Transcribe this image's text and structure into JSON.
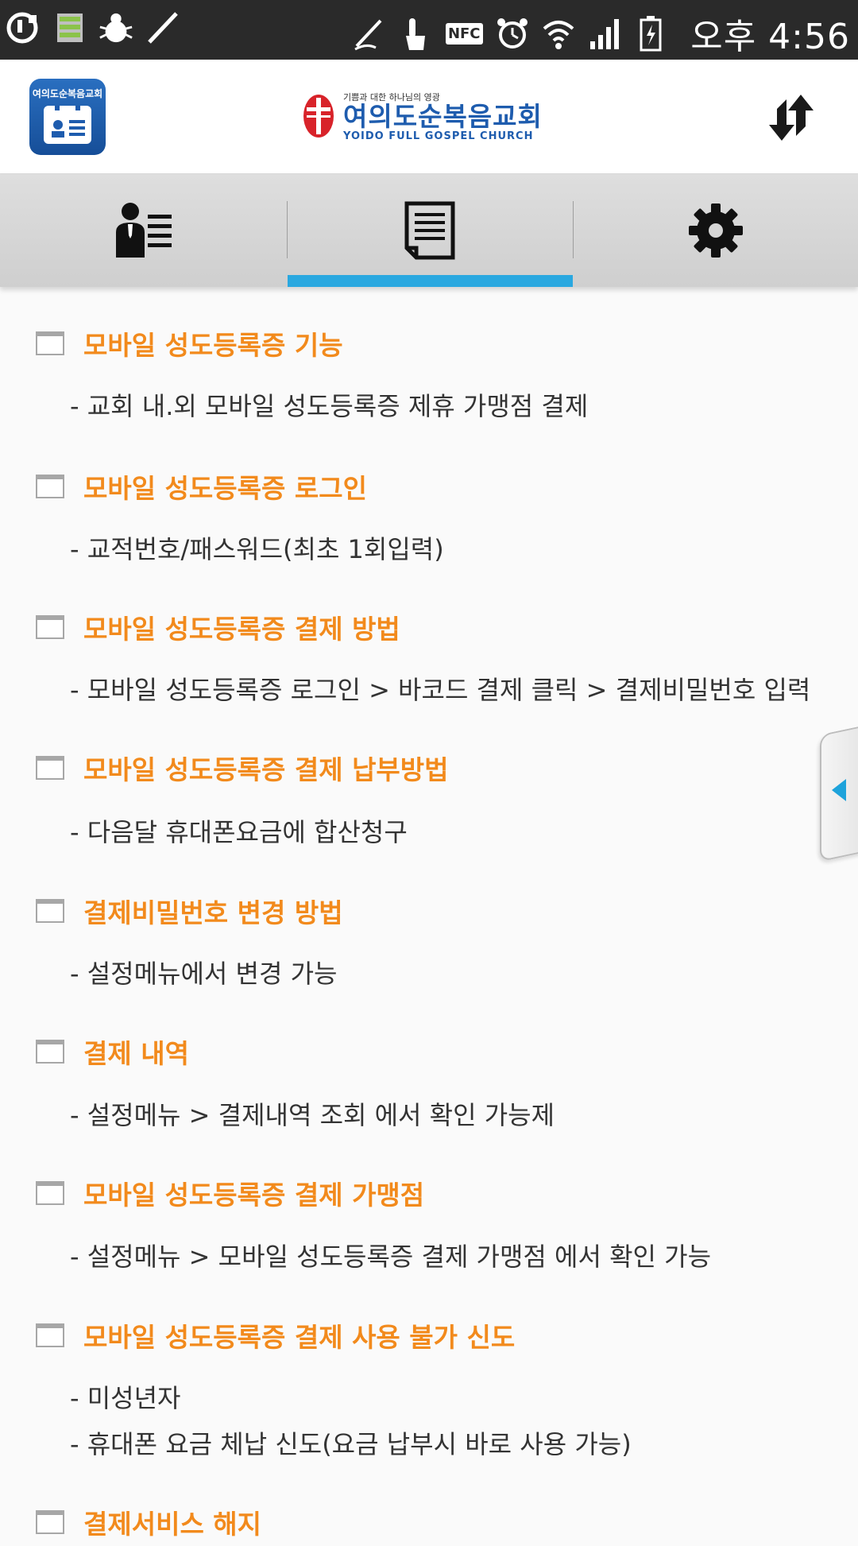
{
  "status_bar": {
    "time": "오후 4:56",
    "nfc_label": "NFC",
    "left_icons": [
      "uplus-icon",
      "storage-icon",
      "bug-icon",
      "pen-icon"
    ],
    "right_icons": [
      "stylus-icon",
      "touch-icon",
      "nfc-icon",
      "alarm-icon",
      "wifi-icon",
      "signal-icon",
      "battery-icon"
    ]
  },
  "header": {
    "app_icon_label": "여의도순복음교회",
    "logo_subtitle": "기쁨과 대한 하나님의 영광",
    "logo_title": "여의도순복음교회",
    "logo_english": "YOIDO FULL GOSPEL CHURCH",
    "refresh_icon": "sync-icon"
  },
  "tabs": [
    {
      "icon": "member-card-icon",
      "selected": false
    },
    {
      "icon": "document-icon",
      "selected": true
    },
    {
      "icon": "gear-icon",
      "selected": false
    }
  ],
  "accent_colors": {
    "title": "#f28a1c",
    "tab_indicator": "#2aa8e0",
    "side_arrow": "#1ea3db"
  },
  "sections": [
    {
      "title": "모바일 성도등록증 기능",
      "lines": [
        "- 교회 내.외 모바일 성도등록증 제휴 가맹점 결제"
      ]
    },
    {
      "title": "모바일 성도등록증 로그인",
      "lines": [
        "- 교적번호/패스워드(최초 1회입력)"
      ]
    },
    {
      "title": "모바일 성도등록증 결제 방법",
      "lines": [
        "- 모바일 성도등록증 로그인 > 바코드 결제 클릭 > 결제비밀번호 입력"
      ]
    },
    {
      "title": "모바일 성도등록증 결제 납부방법",
      "lines": [
        "- 다음달 휴대폰요금에 합산청구"
      ]
    },
    {
      "title": "결제비밀번호 변경 방법",
      "lines": [
        "- 설정메뉴에서 변경 가능"
      ]
    },
    {
      "title": "결제 내역",
      "lines": [
        "- 설정메뉴 > 결제내역 조회 에서 확인 가능제"
      ]
    },
    {
      "title": "모바일 성도등록증 결제 가맹점",
      "lines": [
        "- 설정메뉴 > 모바일 성도등록증 결제 가맹점 에서 확인 가능"
      ]
    },
    {
      "title": "모바일 성도등록증 결제 사용 불가 신도",
      "lines": [
        "- 미성년자",
        "- 휴대폰 요금 체납 신도(요금 납부시 바로 사용 가능)"
      ]
    },
    {
      "title": "결제서비스 해지",
      "lines": []
    }
  ]
}
